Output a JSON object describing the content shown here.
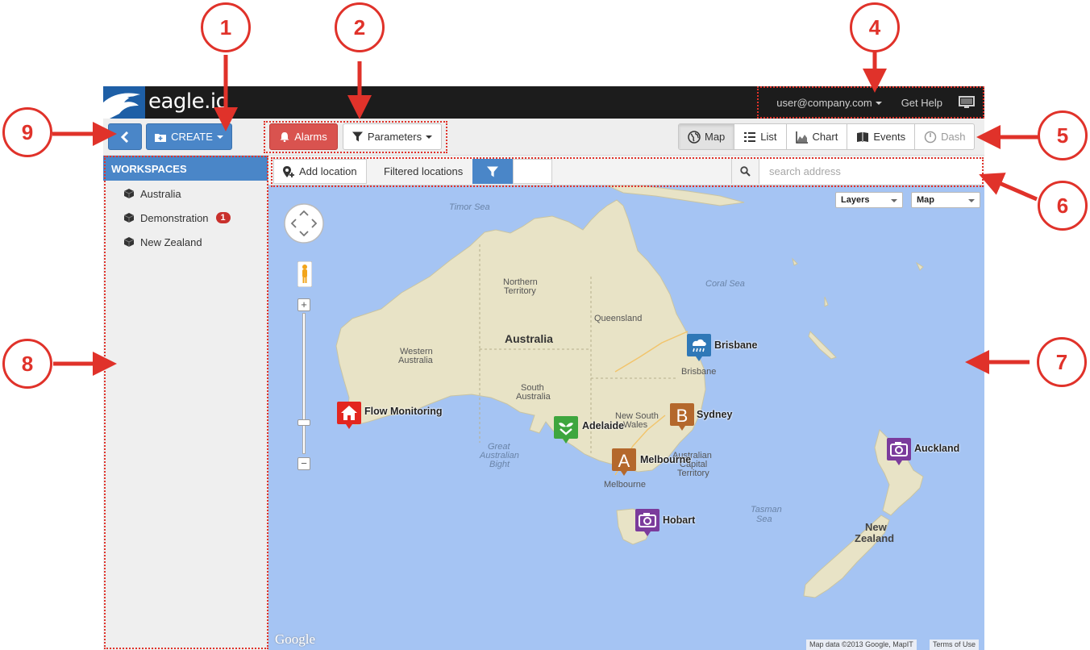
{
  "app": {
    "brand": "eagle.io"
  },
  "header": {
    "user_menu": "user@company.com",
    "help_link": "Get Help",
    "monitor_icon": "monitor-icon"
  },
  "toolbar": {
    "create_label": "CREATE",
    "alarms_label": "Alarms",
    "parameters_label": "Parameters",
    "views": [
      {
        "label": "Map",
        "icon": "globe-icon"
      },
      {
        "label": "List",
        "icon": "list-icon"
      },
      {
        "label": "Chart",
        "icon": "chart-icon"
      },
      {
        "label": "Events",
        "icon": "book-icon"
      },
      {
        "label": "Dash",
        "icon": "gauge-icon"
      }
    ],
    "active_view": "Map"
  },
  "sidebar": {
    "heading": "WORKSPACES",
    "items": [
      {
        "label": "Australia"
      },
      {
        "label": "Demonstration",
        "badge": "1"
      },
      {
        "label": "New Zealand"
      }
    ]
  },
  "map_toolbar": {
    "add_location": "Add location",
    "filtered_locations": "Filtered locations",
    "search_placeholder": "search address"
  },
  "map": {
    "layers_select": "Layers",
    "maptype_select": "Map",
    "labels": {
      "timor_sea": "Timor Sea",
      "coral_sea": "Coral Sea",
      "tasman_sea_1": "Tasman",
      "tasman_sea_2": "Sea",
      "great_bight_1": "Great",
      "great_bight_2": "Australian",
      "great_bight_3": "Bight",
      "northern_territory_1": "Northern",
      "northern_territory_2": "Territory",
      "queensland": "Queensland",
      "western_australia_1": "Western",
      "western_australia_2": "Australia",
      "south_australia_1": "South",
      "south_australia_2": "Australia",
      "nsw_1": "New South",
      "nsw_2": "Wales",
      "act_1": "Australian",
      "act_2": "Capital",
      "act_3": "Territory",
      "australia": "Australia",
      "new_zealand_1": "New",
      "new_zealand_2": "Zealand",
      "brisbane_city": "Brisbane",
      "melbourne_city": "Melbourne"
    },
    "markers": [
      {
        "name": "Brisbane",
        "icon": "rain-icon",
        "color": "#2f78b7"
      },
      {
        "name": "Flow Monitoring",
        "icon": "house-icon",
        "color": "#e3261f"
      },
      {
        "name": "Adelaide",
        "icon": "plant-icon",
        "color": "#3ea63e"
      },
      {
        "name": "Sydney",
        "icon": "letter-b-icon",
        "color": "#b4682c",
        "letter": "B"
      },
      {
        "name": "Melbourne",
        "icon": "letter-a-icon",
        "color": "#b4682c",
        "letter": "A"
      },
      {
        "name": "Auckland",
        "icon": "camera-icon",
        "color": "#7b3b9c"
      },
      {
        "name": "Hobart",
        "icon": "camera-icon",
        "color": "#7b3b9c"
      }
    ],
    "attribution": "Map data ©2013 Google, MapIT",
    "terms": "Terms of Use",
    "google": "Google"
  },
  "callouts": [
    "1",
    "2",
    "4",
    "5",
    "6",
    "7",
    "8",
    "9"
  ],
  "colors": {
    "accent": "#4a86c8",
    "alarm": "#d9534f",
    "annotation": "#e0322a"
  }
}
